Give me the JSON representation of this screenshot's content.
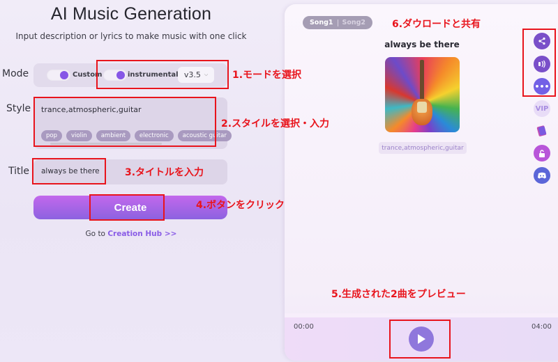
{
  "header": {
    "title": "AI Music Generation",
    "subtitle": "Input description or lyrics to make music with one click"
  },
  "form": {
    "mode_label": "Mode",
    "mode_options": [
      {
        "label": "Custom",
        "enabled": true
      },
      {
        "label": "instrumental",
        "enabled": true
      }
    ],
    "version": "v3.5",
    "style_label": "Style",
    "style_value": "trance,atmospheric,guitar",
    "style_tags": [
      "pop",
      "violin",
      "ambient",
      "electronic",
      "acoustic guitar"
    ],
    "title_label": "Title",
    "title_value": "always be there",
    "create_label": "Create",
    "goto_prefix": "Go to",
    "goto_link": "Creation Hub >>"
  },
  "preview": {
    "song_tabs": [
      "Song1",
      "Song2"
    ],
    "active_song": "Song1",
    "song_title": "always be there",
    "style_chip": "trance,atmospheric,guitar",
    "side_icons": [
      "share-icon",
      "audio-wave-icon",
      "more-icon",
      "vip-icon",
      "book-icon",
      "unlock-icon",
      "discord-icon"
    ],
    "vip_label": "VIP",
    "more_label": "•••",
    "time_current": "00:00",
    "time_total": "04:00"
  },
  "annotations": {
    "step1": "1.モードを選択",
    "step2": "2.スタイルを選択・入力",
    "step3": "3.タイトルを入力",
    "step4": "4.ボタンをクリック",
    "step5": "5.生成された2曲をプレビュー",
    "step6": "6.ダウロードと共有"
  },
  "colors": {
    "accent": "#8657e6",
    "annotation_red": "#e8141c",
    "create_gradient_top": "#c368ec",
    "create_gradient_bottom": "#8c62e0"
  }
}
